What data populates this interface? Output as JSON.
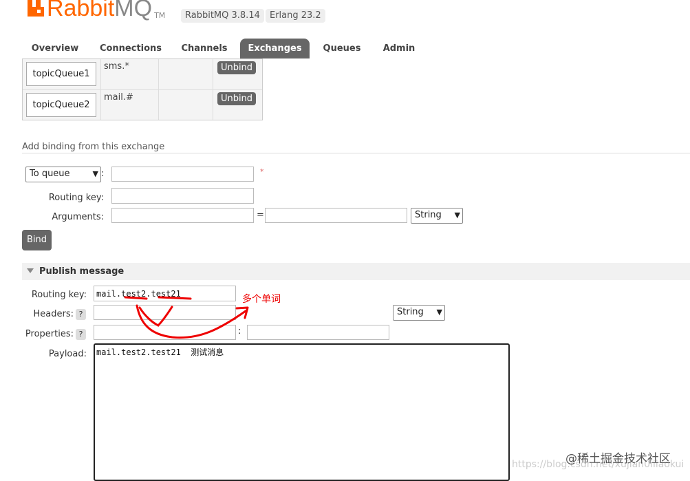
{
  "header": {
    "logo_brand": "Rabbit",
    "logo_suffix": "MQ",
    "logo_tm": "TM",
    "version_rabbitmq": "RabbitMQ 3.8.14",
    "version_erlang": "Erlang 23.2"
  },
  "nav": {
    "tabs": [
      {
        "label": "Overview",
        "active": false
      },
      {
        "label": "Connections",
        "active": false
      },
      {
        "label": "Channels",
        "active": false
      },
      {
        "label": "Exchanges",
        "active": true
      },
      {
        "label": "Queues",
        "active": false
      },
      {
        "label": "Admin",
        "active": false
      }
    ]
  },
  "bindings": {
    "rows": [
      {
        "queue": "topicQueue1",
        "routing_key": "sms.*",
        "action": "Unbind"
      },
      {
        "queue": "topicQueue2",
        "routing_key": "mail.#",
        "action": "Unbind"
      }
    ]
  },
  "add_binding": {
    "title": "Add binding from this exchange",
    "destination_select": "To queue",
    "colon": ":",
    "required_mark": "*",
    "routing_key_label": "Routing key:",
    "arguments_label": "Arguments:",
    "equals": "=",
    "type_select": "String",
    "bind_button": "Bind"
  },
  "publish": {
    "title": "Publish message",
    "routing_key_label": "Routing key:",
    "routing_key_value": "mail.test2.test21",
    "headers_label": "Headers:",
    "properties_label": "Properties:",
    "help_mark": "?",
    "colon": ":",
    "headers_type_select": "String",
    "payload_label": "Payload:",
    "payload_value": "mail.test2.test21  测试消息"
  },
  "annotation": {
    "text": "多个单词",
    "color": "#e00000"
  },
  "watermark": {
    "text": "@稀土掘金技术社区",
    "url": "https://blog.csdn.net/xujian0iiiaokui"
  },
  "colors": {
    "brand": "#ff6600",
    "tab_active": "#666666",
    "button": "#666666"
  }
}
